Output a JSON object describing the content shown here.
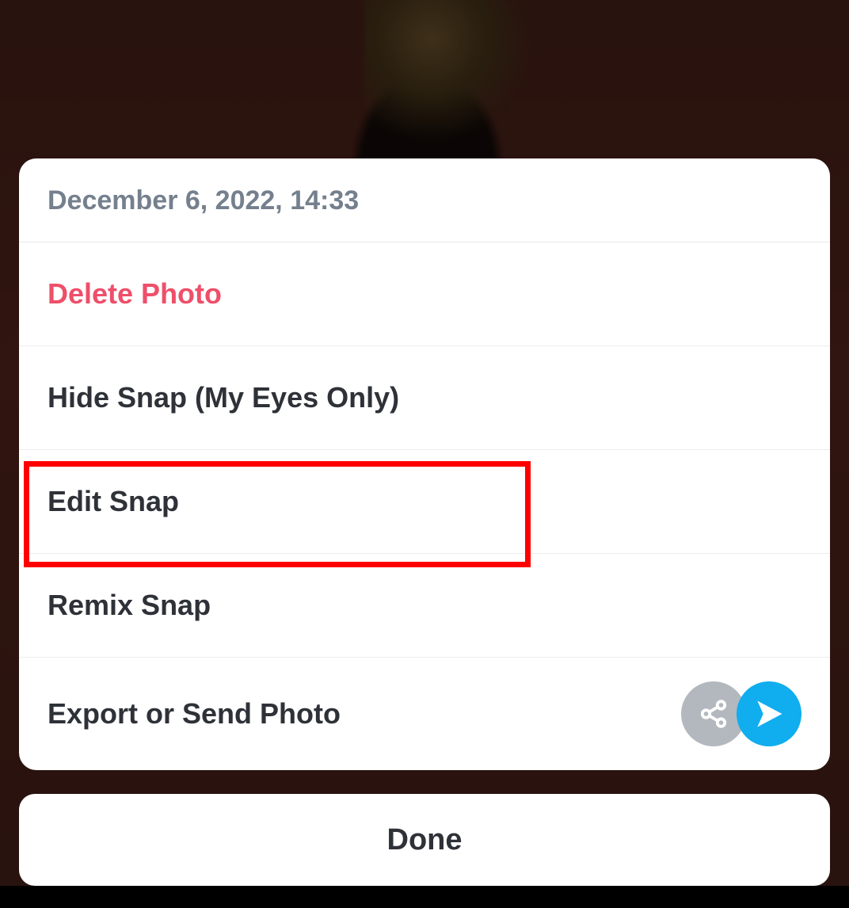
{
  "sheet": {
    "timestamp": "December 6, 2022, 14:33",
    "items": [
      {
        "label": "Delete Photo"
      },
      {
        "label": "Hide Snap (My Eyes Only)"
      },
      {
        "label": "Edit Snap"
      },
      {
        "label": "Remix Snap"
      },
      {
        "label": "Export or Send Photo"
      }
    ]
  },
  "done_label": "Done",
  "icons": {
    "share": "share-icon",
    "send": "send-icon"
  },
  "highlight": {
    "target_index": 2
  }
}
